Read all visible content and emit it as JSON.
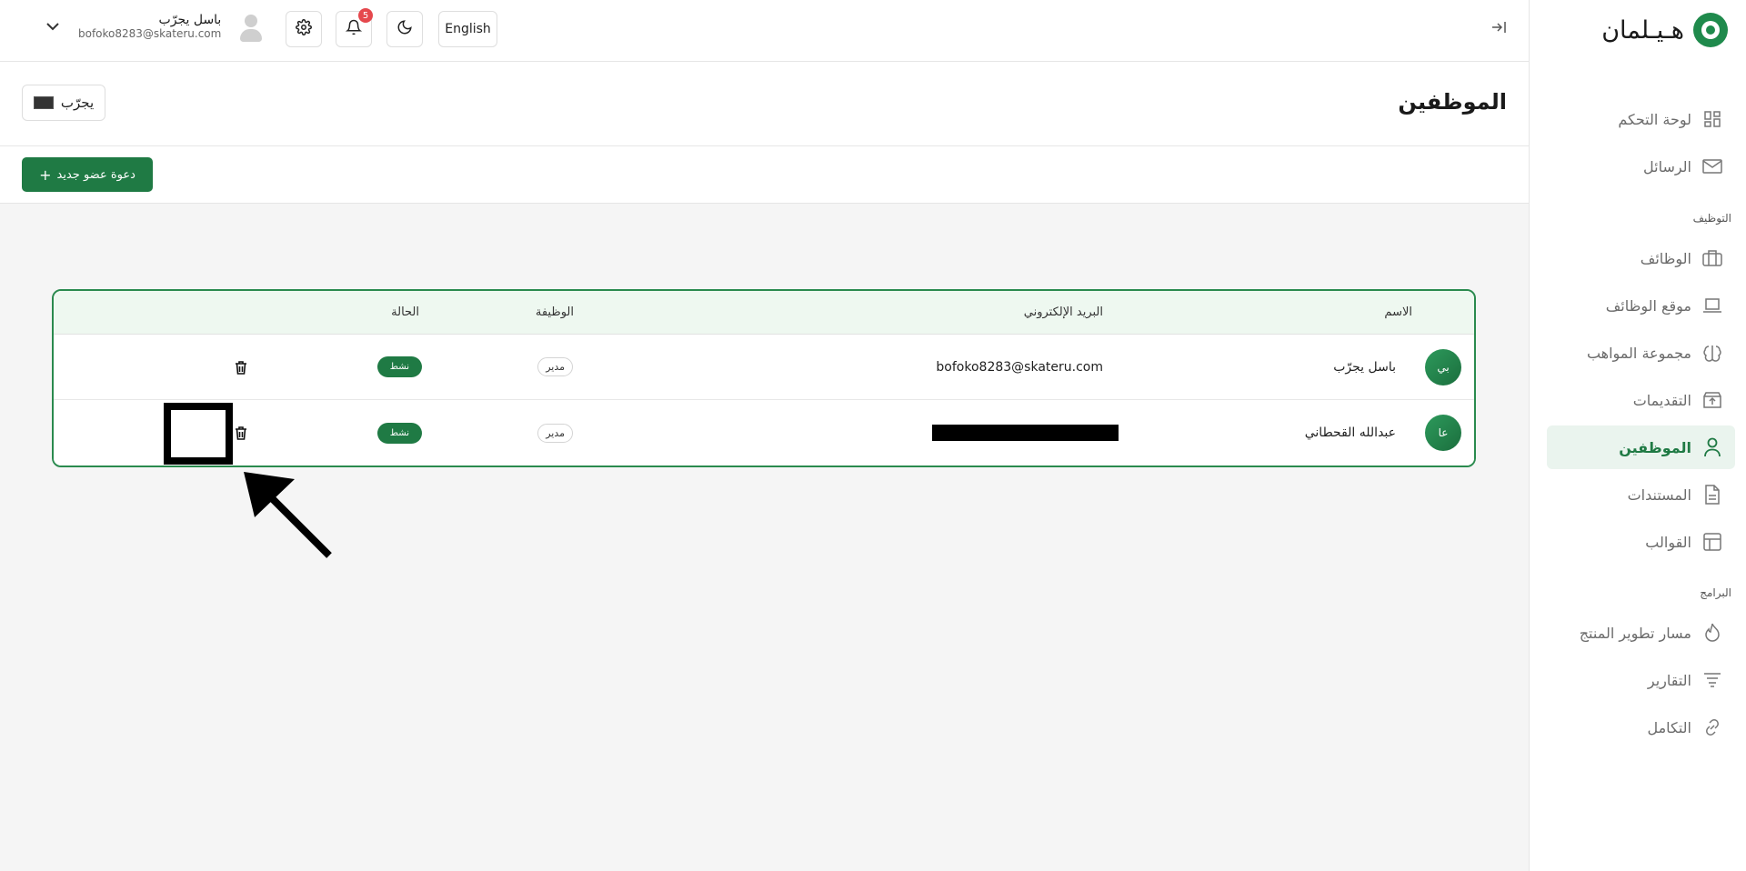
{
  "sidebar": {
    "logo_text": "هـيـلمان",
    "items": [
      {
        "label": "لوحة التحكم",
        "icon": "dashboard-icon"
      },
      {
        "label": "الرسائل",
        "icon": "mail-icon"
      },
      {
        "label": "الوظائف",
        "icon": "briefcase-icon"
      },
      {
        "label": "موقع الوظائف",
        "icon": "laptop-icon"
      },
      {
        "label": "مجموعة المواهب",
        "icon": "brain-icon"
      },
      {
        "label": "التقديمات",
        "icon": "upload-icon"
      },
      {
        "label": "الموظفين",
        "icon": "user-icon",
        "active": true
      },
      {
        "label": "المستندات",
        "icon": "document-icon"
      },
      {
        "label": "القوالب",
        "icon": "template-icon"
      },
      {
        "label": "مسار تطوير المنتج",
        "icon": "flame-icon"
      },
      {
        "label": "التقارير",
        "icon": "filter-lines-icon"
      },
      {
        "label": "التكامل",
        "icon": "link-icon"
      }
    ],
    "sections": {
      "hiring": "التوظيف",
      "programs": "البرامج"
    }
  },
  "header": {
    "user_name": "باسل يجرّب",
    "user_email": "bofoko8283@skateru.com",
    "notification_count": "5",
    "language_button": "English"
  },
  "page": {
    "title": "الموظفين",
    "company_button": "يجرّب",
    "invite_button": "دعوة عضو جديد"
  },
  "table": {
    "headers": {
      "name": "الاسم",
      "email": "البريد الإلكتروني",
      "role": "الوظيفة",
      "status": "الحالة"
    },
    "rows": [
      {
        "initials": "بي",
        "name": "باسل يجرّب",
        "email": "bofoko8283@skateru.com",
        "role": "مدير",
        "status": "نشط"
      },
      {
        "initials": "عا",
        "name": "عبدالله القحطاني",
        "email": "",
        "role": "مدير",
        "status": "نشط"
      }
    ]
  },
  "colors": {
    "accent": "#1f7a44",
    "border_highlight": "#2a8a4e",
    "badge": "#e5484d"
  }
}
